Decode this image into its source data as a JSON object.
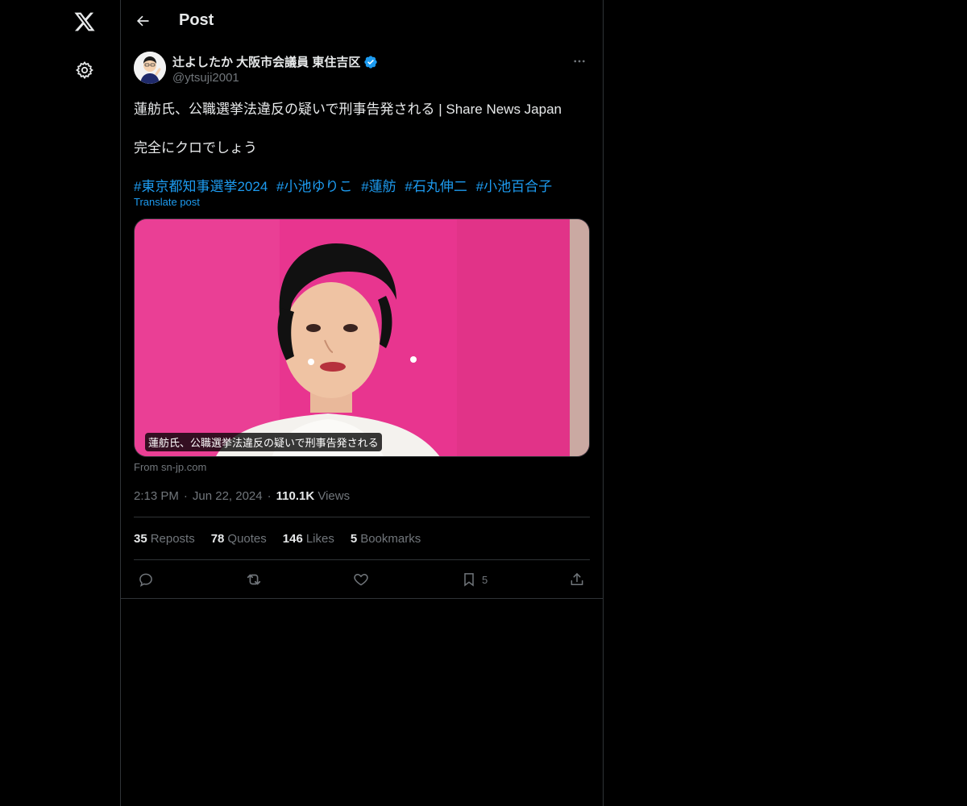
{
  "header": {
    "title": "Post"
  },
  "author": {
    "name": "辻よしたか 大阪市会議員 東住吉区",
    "handle": "@ytsuji2001",
    "verified": true
  },
  "post": {
    "line1": "蓮舫氏、公職選挙法違反の疑いで刑事告発される | Share News Japan",
    "line2": "完全にクロでしょう",
    "hashtags": [
      "#東京都知事選挙2024",
      "#小池ゆりこ",
      "#蓮舫",
      "#石丸伸二",
      "#小池百合子"
    ],
    "translate_label": "Translate post",
    "media_caption": "蓮舫氏、公職選挙法違反の疑いで刑事告発される",
    "source": "From sn-jp.com",
    "time": "2:13 PM",
    "date": "Jun 22, 2024",
    "views_count": "110.1K",
    "views_label": "Views"
  },
  "stats": {
    "reposts": {
      "num": "35",
      "label": "Reposts"
    },
    "quotes": {
      "num": "78",
      "label": "Quotes"
    },
    "likes": {
      "num": "146",
      "label": "Likes"
    },
    "bookmarks": {
      "num": "5",
      "label": "Bookmarks"
    }
  },
  "actions": {
    "bookmark_count": "5"
  },
  "icons": {
    "logo": "x-logo-icon",
    "settings": "gear-icon",
    "back": "arrow-left-icon",
    "more": "more-dots-icon",
    "verified": "verified-badge-icon",
    "reply": "reply-icon",
    "repost": "repost-icon",
    "like": "heart-icon",
    "bookmark": "bookmark-icon",
    "share": "share-icon"
  },
  "colors": {
    "background": "#000000",
    "text": "#e7e9ea",
    "muted": "#71767b",
    "accent": "#1d9bf0",
    "border": "#2f3336"
  }
}
